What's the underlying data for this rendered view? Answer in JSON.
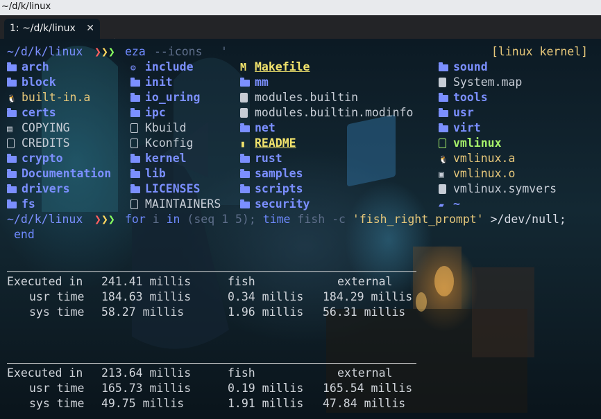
{
  "window": {
    "title": "~/d/k/linux"
  },
  "tabs": [
    {
      "label": "1: ~/d/k/linux",
      "close": "✕"
    }
  ],
  "new_tab": "+",
  "prompt1": {
    "path": "~/d/k/linux",
    "arrows": "❯❯❯",
    "command": "eza",
    "args": "--icons",
    "cursor": "'",
    "right_prompt": "[linux kernel]"
  },
  "listing": {
    "col1": [
      {
        "name": "arch",
        "type": "dir",
        "icon": "folder-icon"
      },
      {
        "name": "block",
        "type": "dir",
        "icon": "folder-icon"
      },
      {
        "name": "built-in.a",
        "type": "obj",
        "icon": "tux-icon"
      },
      {
        "name": "certs",
        "type": "dir",
        "icon": "folder-icon"
      },
      {
        "name": "COPYING",
        "type": "file",
        "icon": "license-icon"
      },
      {
        "name": "CREDITS",
        "type": "file",
        "icon": "file-icon"
      },
      {
        "name": "crypto",
        "type": "dir",
        "icon": "folder-icon"
      },
      {
        "name": "Documentation",
        "type": "dir",
        "icon": "folder-icon"
      },
      {
        "name": "drivers",
        "type": "dir",
        "icon": "folder-icon"
      },
      {
        "name": "fs",
        "type": "dir",
        "icon": "folder-icon"
      }
    ],
    "col2": [
      {
        "name": "include",
        "type": "dir",
        "icon": "folder-config-icon"
      },
      {
        "name": "init",
        "type": "dir",
        "icon": "folder-icon"
      },
      {
        "name": "io_uring",
        "type": "dir",
        "icon": "folder-icon"
      },
      {
        "name": "ipc",
        "type": "dir",
        "icon": "folder-icon"
      },
      {
        "name": "Kbuild",
        "type": "file",
        "icon": "file-icon"
      },
      {
        "name": "Kconfig",
        "type": "file",
        "icon": "file-icon"
      },
      {
        "name": "kernel",
        "type": "dir",
        "icon": "folder-icon"
      },
      {
        "name": "lib",
        "type": "dir",
        "icon": "folder-icon"
      },
      {
        "name": "LICENSES",
        "type": "dir",
        "icon": "folder-icon"
      },
      {
        "name": "MAINTAINERS",
        "type": "file",
        "icon": "file-icon"
      }
    ],
    "col3": [
      {
        "name": "Makefile",
        "type": "special",
        "icon": "makefile-icon"
      },
      {
        "name": "mm",
        "type": "dir",
        "icon": "folder-icon"
      },
      {
        "name": "modules.builtin",
        "type": "file",
        "icon": "file-filled-icon"
      },
      {
        "name": "modules.builtin.modinfo",
        "type": "file",
        "icon": "file-filled-icon"
      },
      {
        "name": "net",
        "type": "dir",
        "icon": "folder-icon"
      },
      {
        "name": "README",
        "type": "special",
        "icon": "readme-icon"
      },
      {
        "name": "rust",
        "type": "dir",
        "icon": "folder-icon"
      },
      {
        "name": "samples",
        "type": "dir",
        "icon": "folder-icon"
      },
      {
        "name": "scripts",
        "type": "dir",
        "icon": "folder-icon"
      },
      {
        "name": "security",
        "type": "dir",
        "icon": "folder-icon"
      }
    ],
    "col4": [
      {
        "name": "sound",
        "type": "dir",
        "icon": "folder-icon"
      },
      {
        "name": "System.map",
        "type": "file",
        "icon": "file-filled-icon"
      },
      {
        "name": "tools",
        "type": "dir",
        "icon": "folder-icon"
      },
      {
        "name": "usr",
        "type": "dir",
        "icon": "folder-icon"
      },
      {
        "name": "virt",
        "type": "dir",
        "icon": "folder-icon"
      },
      {
        "name": "vmlinux",
        "type": "exe",
        "icon": "file-icon"
      },
      {
        "name": "vmlinux.a",
        "type": "obj",
        "icon": "tux-icon"
      },
      {
        "name": "vmlinux.o",
        "type": "obj",
        "icon": "binary-icon"
      },
      {
        "name": "vmlinux.symvers",
        "type": "file",
        "icon": "file-filled-icon"
      },
      {
        "name": "~",
        "type": "dir",
        "icon": "folder-open-icon"
      }
    ]
  },
  "prompt2": {
    "path": "~/d/k/linux",
    "arrows": "❯❯❯",
    "p_for": "for",
    "p_i": " i ",
    "p_in": "in",
    "p_seq": " (seq 1 5); ",
    "p_time": "time",
    "p_fish": " fish ",
    "p_c": "-c ",
    "p_str": "'fish_right_prompt'",
    "p_redir": " >/dev/null;",
    "p_end": "end"
  },
  "timings": [
    {
      "executed_label": "Executed in",
      "executed_value": "241.41 millis",
      "fish_header": "fish",
      "external_header": "external",
      "rows": [
        {
          "label": "usr time",
          "total": "184.63 millis",
          "fish": "0.34 millis",
          "external": "184.29 millis"
        },
        {
          "label": "sys time",
          "total": "58.27 millis",
          "fish": "1.96 millis",
          "external": "56.31 millis"
        }
      ]
    },
    {
      "executed_label": "Executed in",
      "executed_value": "213.64 millis",
      "fish_header": "fish",
      "external_header": "external",
      "rows": [
        {
          "label": "usr time",
          "total": "165.73 millis",
          "fish": "0.19 millis",
          "external": "165.54 millis"
        },
        {
          "label": "sys time",
          "total": "49.75 millis",
          "fish": "1.91 millis",
          "external": "47.84 millis"
        }
      ]
    }
  ],
  "colors": {
    "dir": "#7b8fff",
    "exe": "#a6f06a",
    "special": "#f2e36c",
    "prompt_arrow_1": "#ff5f5f",
    "prompt_arrow_2": "#ffd75f",
    "prompt_arrow_3": "#87ff5f"
  }
}
